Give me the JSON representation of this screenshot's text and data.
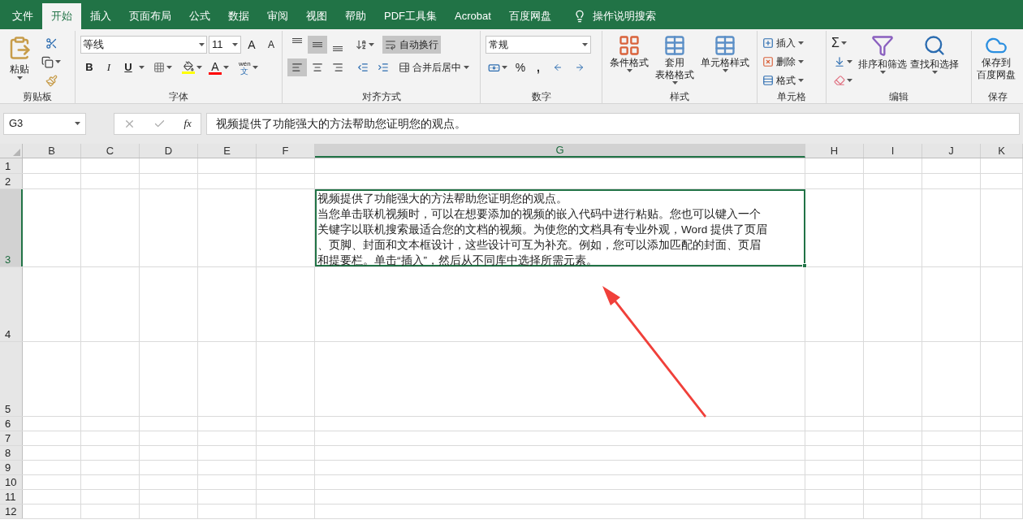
{
  "tabs": [
    {
      "label": "文件",
      "selected": false
    },
    {
      "label": "开始",
      "selected": true
    },
    {
      "label": "插入",
      "selected": false
    },
    {
      "label": "页面布局",
      "selected": false
    },
    {
      "label": "公式",
      "selected": false
    },
    {
      "label": "数据",
      "selected": false
    },
    {
      "label": "审阅",
      "selected": false
    },
    {
      "label": "视图",
      "selected": false
    },
    {
      "label": "帮助",
      "selected": false
    },
    {
      "label": "PDF工具集",
      "selected": false
    },
    {
      "label": "Acrobat",
      "selected": false
    },
    {
      "label": "百度网盘",
      "selected": false
    }
  ],
  "tell_me": "操作说明搜索",
  "ribbon": {
    "clipboard": {
      "label": "剪贴板",
      "paste": "粘贴"
    },
    "font": {
      "label": "字体",
      "font_name": "等线",
      "font_size": "11",
      "grow": "A",
      "shrink": "A",
      "bold": "B",
      "italic": "I",
      "underline": "U",
      "font_color": "A",
      "phonetic": "wén",
      "phonetic_char": "文"
    },
    "alignment": {
      "label": "对齐方式",
      "vertical": [
        {
          "selected": false
        },
        {
          "selected": true
        },
        {
          "selected": false
        }
      ],
      "horizontal": [
        {
          "selected": true
        },
        {
          "selected": false
        },
        {
          "selected": false
        }
      ],
      "wrap_text": {
        "label": "自动换行",
        "on": true
      },
      "merge": "合并后居中"
    },
    "number": {
      "label": "数字",
      "format": "常规",
      "percent": "%",
      "comma": ","
    },
    "styles": {
      "label": "样式",
      "buttons": [
        [
          "条件格式"
        ],
        [
          "套用",
          "表格格式"
        ],
        [
          "单元格样式"
        ]
      ]
    },
    "cells": {
      "label": "单元格",
      "buttons": [
        "插入",
        "删除",
        "格式"
      ]
    },
    "editing": {
      "label": "编辑",
      "sum": "Σ",
      "buttons": [
        "排序和筛选",
        "查找和选择"
      ]
    },
    "save": {
      "label": "保存",
      "button": [
        "保存到",
        "百度网盘"
      ]
    }
  },
  "formula_bar": {
    "name_box": "G3",
    "fx": "fx",
    "formula": "视频提供了功能强大的方法帮助您证明您的观点。"
  },
  "sheet": {
    "columns": [
      {
        "label": "B",
        "selected": false
      },
      {
        "label": "C",
        "selected": false
      },
      {
        "label": "D",
        "selected": false
      },
      {
        "label": "E",
        "selected": false
      },
      {
        "label": "F",
        "selected": false
      },
      {
        "label": "G",
        "selected": true
      },
      {
        "label": "H",
        "selected": false
      },
      {
        "label": "I",
        "selected": false
      },
      {
        "label": "J",
        "selected": false
      },
      {
        "label": "K",
        "selected": false
      }
    ],
    "rows": [
      {
        "label": "1",
        "selected": false
      },
      {
        "label": "2",
        "selected": false
      },
      {
        "label": "3",
        "selected": true
      },
      {
        "label": "4",
        "selected": false
      },
      {
        "label": "5",
        "selected": false
      },
      {
        "label": "6",
        "selected": false
      },
      {
        "label": "7",
        "selected": false
      },
      {
        "label": "8",
        "selected": false
      },
      {
        "label": "9",
        "selected": false
      },
      {
        "label": "10",
        "selected": false
      },
      {
        "label": "11",
        "selected": false
      },
      {
        "label": "12",
        "selected": false
      }
    ],
    "active_cell": {
      "lines": [
        "视频提供了功能强大的方法帮助您证明您的观点。",
        "当您单击联机视频时，可以在想要添加的视频的嵌入代码中进行粘贴。您也可以键入一个",
        "关键字以联机搜索最适合您的文档的视频。为使您的文档具有专业外观，Word 提供了页眉",
        "、页脚、封面和文本框设计，这些设计可互为补充。例如，您可以添加匹配的封面、页眉",
        "和提要栏。单击“插入”，然后从不同库中选择所需元素。"
      ]
    }
  }
}
